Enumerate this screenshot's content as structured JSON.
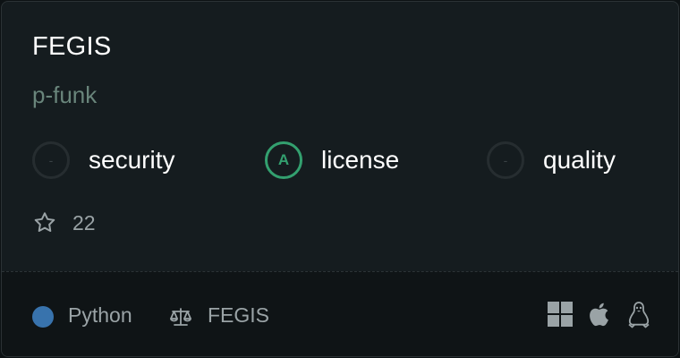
{
  "repo": {
    "name": "FEGIS",
    "owner": "p-funk"
  },
  "badges": [
    {
      "grade": "-",
      "label": "security",
      "graded": false
    },
    {
      "grade": "A",
      "label": "license",
      "graded": true
    },
    {
      "grade": "-",
      "label": "quality",
      "graded": false
    }
  ],
  "stars": {
    "icon": "star-icon",
    "count": "22"
  },
  "footer": {
    "language": "Python",
    "language_color": "#3873ad",
    "license_icon": "scale-icon",
    "license": "FEGIS",
    "platforms": [
      "windows-icon",
      "apple-icon",
      "linux-icon"
    ]
  },
  "colors": {
    "accent_green": "#33a06f",
    "owner_text": "#69857b",
    "background": "#151c1f"
  }
}
